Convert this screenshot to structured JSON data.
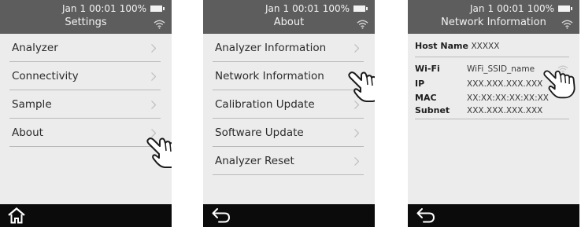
{
  "status": {
    "date": "Jan",
    "day": "1",
    "time": "00:01",
    "battery": "100%"
  },
  "screens": [
    {
      "title": "Settings",
      "items": [
        "Analyzer",
        "Connectivity",
        "Sample",
        "About"
      ],
      "bottom_icon": "home-icon"
    },
    {
      "title": "About",
      "items": [
        "Analyzer Information",
        "Network Information",
        "Calibration Update",
        "Software Update",
        "Analyzer Reset"
      ],
      "bottom_icon": "back-arrow-icon"
    },
    {
      "title": "Network Information",
      "host_name_label": "Host Name",
      "host_name_value": "XXXXX",
      "wifi_label": "Wi-Fi",
      "wifi_value": "WiFi_SSID_name",
      "ip_label": "IP",
      "ip_value": "XXX.XXX.XXX.XXX",
      "mac_label": "MAC",
      "mac_value": "XX:XX:XX:XX:XX:XX",
      "subnet_label": "Subnet",
      "subnet_value": "XXX.XXX.XXX.XXX",
      "bottom_icon": "back-arrow-icon"
    }
  ],
  "colors": {
    "header": "#5d5d5d",
    "background": "#ececec",
    "bottom_bar": "#0b0b0b",
    "divider": "#b9b9b9"
  }
}
